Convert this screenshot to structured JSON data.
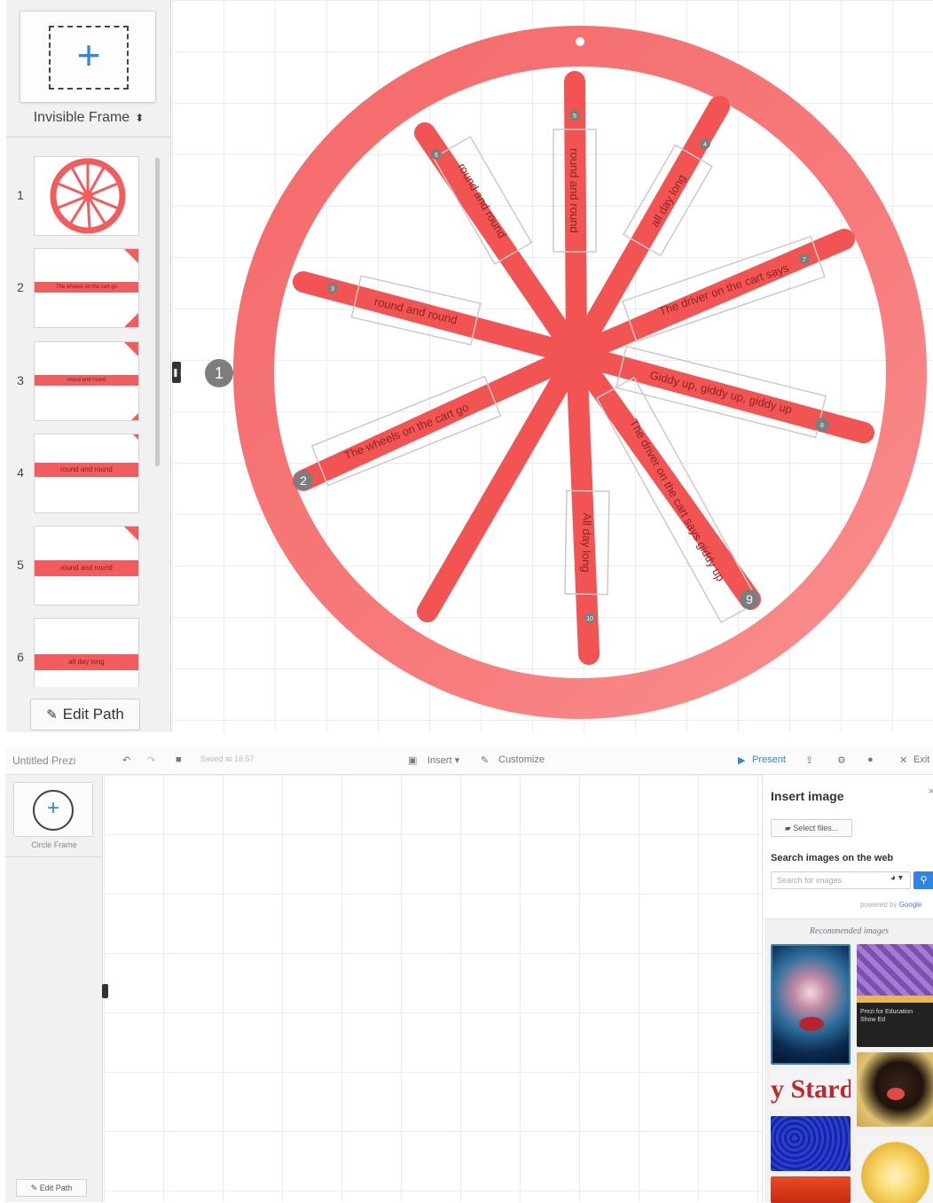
{
  "top": {
    "frame_type_label": "Invisible Frame",
    "frame_type_arrows": "⬍",
    "thumbnails": [
      {
        "number": "1",
        "kind": "wheel",
        "text": ""
      },
      {
        "number": "2",
        "kind": "bar",
        "text": "The wheels on the cart go"
      },
      {
        "number": "3",
        "kind": "bar",
        "text": "round and round"
      },
      {
        "number": "4",
        "kind": "bar",
        "text": "round and round"
      },
      {
        "number": "5",
        "kind": "bar",
        "text": "round and round"
      },
      {
        "number": "6",
        "kind": "bar",
        "text": "all day long"
      }
    ],
    "edit_path_label": "Edit Path",
    "step_badge": "1",
    "toggle_icon": "❚❚",
    "wheel": {
      "ring_color": "#f56b6b",
      "spoke_color": "#f25353",
      "spokes": [
        {
          "text": "round and round",
          "badge": "5"
        },
        {
          "text": "all day long",
          "badge": "4"
        },
        {
          "text": "The driver on the cart says",
          "badge": "7"
        },
        {
          "text": "Giddy up, giddy up, giddy up",
          "badge": "8"
        },
        {
          "text": "The driver on the cart says giddy up",
          "badge": "9"
        },
        {
          "text": "All day long",
          "badge": "10"
        },
        {
          "text": "",
          "badge": ""
        },
        {
          "text": "The wheels on the cart go",
          "badge": "2"
        },
        {
          "text": "round and round",
          "badge": "3"
        },
        {
          "text": "round and round",
          "badge": "6"
        }
      ]
    }
  },
  "bottom": {
    "toolbar": {
      "title": "Untitled Prezi",
      "saved": "Saved at 16:57",
      "insert": "Insert ▾",
      "customize": "Customize",
      "present": "Present",
      "exit": "Exit"
    },
    "sidebar": {
      "frame_label": "Circle Frame",
      "edit_path_label": "Edit Path"
    },
    "insert_panel": {
      "title": "Insert image",
      "select_files": "Select files...",
      "search_title": "Search images on the web",
      "search_placeholder": "Search for images",
      "powered_by": "powered by",
      "powered_brand": "Google",
      "recommended": "Recommended images",
      "rec_caption_text": "Prezi for Education",
      "rec_caption_sub": "Show Ed",
      "star_text": "y Stard"
    }
  }
}
